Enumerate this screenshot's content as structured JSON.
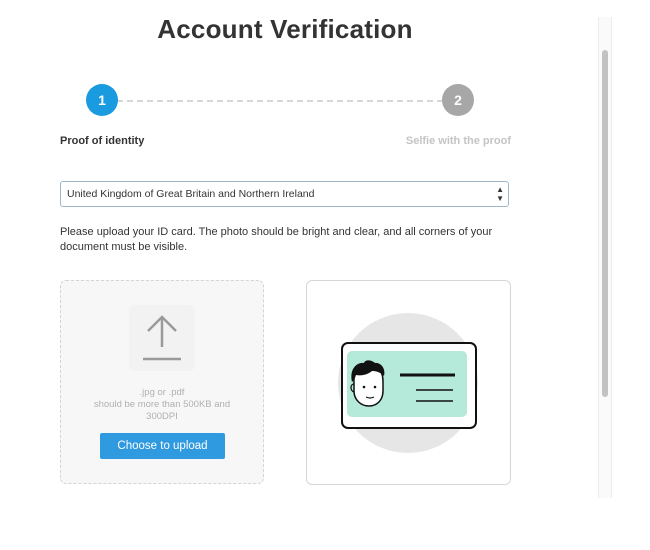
{
  "page": {
    "title": "Account Verification"
  },
  "stepper": {
    "steps": [
      {
        "number": "1",
        "label": "Proof of identity",
        "state": "active",
        "color": "#1a9be0"
      },
      {
        "number": "2",
        "label": "Selfie with the proof",
        "state": "inactive",
        "color": "#a7a7a7"
      }
    ]
  },
  "country_select": {
    "value": "United Kingdom of Great Britain and Northern Ireland",
    "arrows_icon": "updown-arrows-icon"
  },
  "instructions": {
    "text": "Please upload your ID card. The photo should be bright and clear, and all corners of your document must be visible."
  },
  "upload": {
    "icon": "upload-arrow-icon",
    "hint_formats": ".jpg or .pdf",
    "hint_size_line1": "should be more than 500KB and",
    "hint_size_line2": "300DPI",
    "button_label": "Choose to upload",
    "button_color": "#2f9ae0"
  },
  "example": {
    "icon": "id-card-illustration",
    "card_color": "#b5e9da"
  }
}
